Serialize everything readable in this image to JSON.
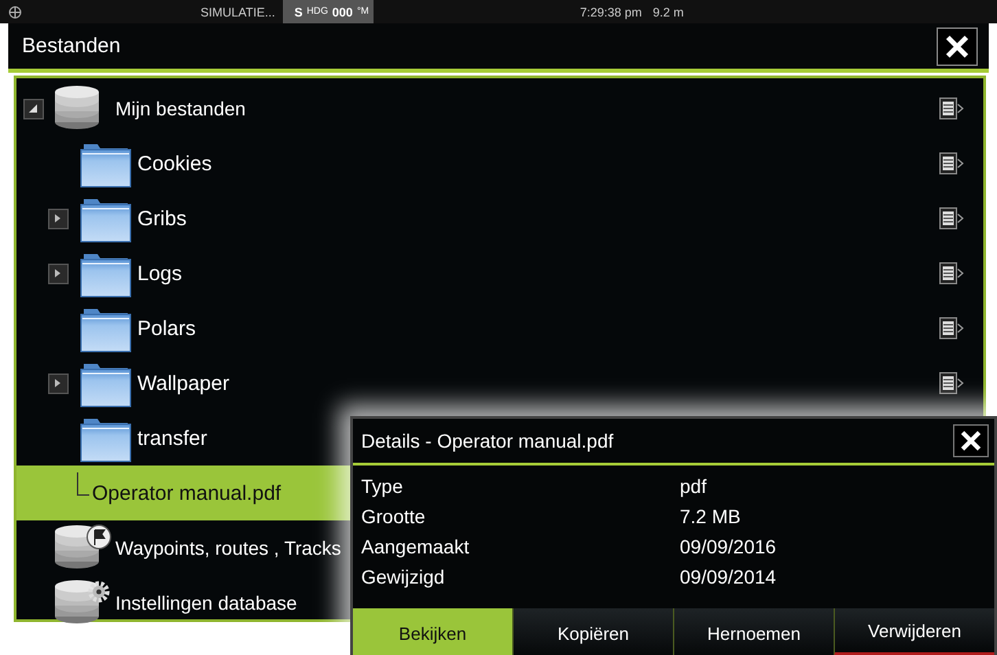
{
  "status_bar": {
    "mode": "SIMULATIE...",
    "heading": {
      "indicator": "S",
      "label": "HDG",
      "value": "000",
      "unit": "°M"
    },
    "time": "7:29:38 pm",
    "depth": "9.2 m"
  },
  "window": {
    "title": "Bestanden"
  },
  "tree": [
    {
      "kind": "database",
      "label": "Mijn bestanden",
      "expanded": true,
      "selected": false,
      "menu": true,
      "children": [
        {
          "kind": "folder",
          "label": "Cookies",
          "selected": false,
          "menu": true
        },
        {
          "kind": "folder",
          "label": "Gribs",
          "expanded": false,
          "selected": false,
          "menu": true
        },
        {
          "kind": "folder",
          "label": "Logs",
          "expanded": false,
          "selected": false,
          "menu": true
        },
        {
          "kind": "folder",
          "label": "Polars",
          "selected": false,
          "menu": true
        },
        {
          "kind": "folder",
          "label": "Wallpaper",
          "expanded": false,
          "selected": false,
          "menu": true
        },
        {
          "kind": "folder",
          "label": "transfer",
          "selected": false,
          "menu": false
        },
        {
          "kind": "file",
          "label": "Operator manual.pdf",
          "selected": true,
          "menu": false
        }
      ]
    },
    {
      "kind": "waypoints",
      "label": "Waypoints, routes , Tracks",
      "selected": false,
      "menu": false
    },
    {
      "kind": "settings",
      "label": "Instellingen database",
      "selected": false,
      "menu": false
    }
  ],
  "dialog": {
    "title": "Details - Operator manual.pdf",
    "fields": [
      {
        "label": "Type",
        "value": "pdf"
      },
      {
        "label": "Grootte",
        "value": "7.2 MB"
      },
      {
        "label": "Aangemaakt",
        "value": "09/09/2016"
      },
      {
        "label": "Gewijzigd",
        "value": "09/09/2014"
      }
    ],
    "buttons": [
      {
        "label": "Bekijken",
        "kind": "normal",
        "selected": true
      },
      {
        "label": "Kopiëren",
        "kind": "normal",
        "selected": false
      },
      {
        "label": "Hernoemen",
        "kind": "normal",
        "selected": false
      },
      {
        "label": "Verwijderen",
        "kind": "danger",
        "selected": false
      }
    ]
  }
}
